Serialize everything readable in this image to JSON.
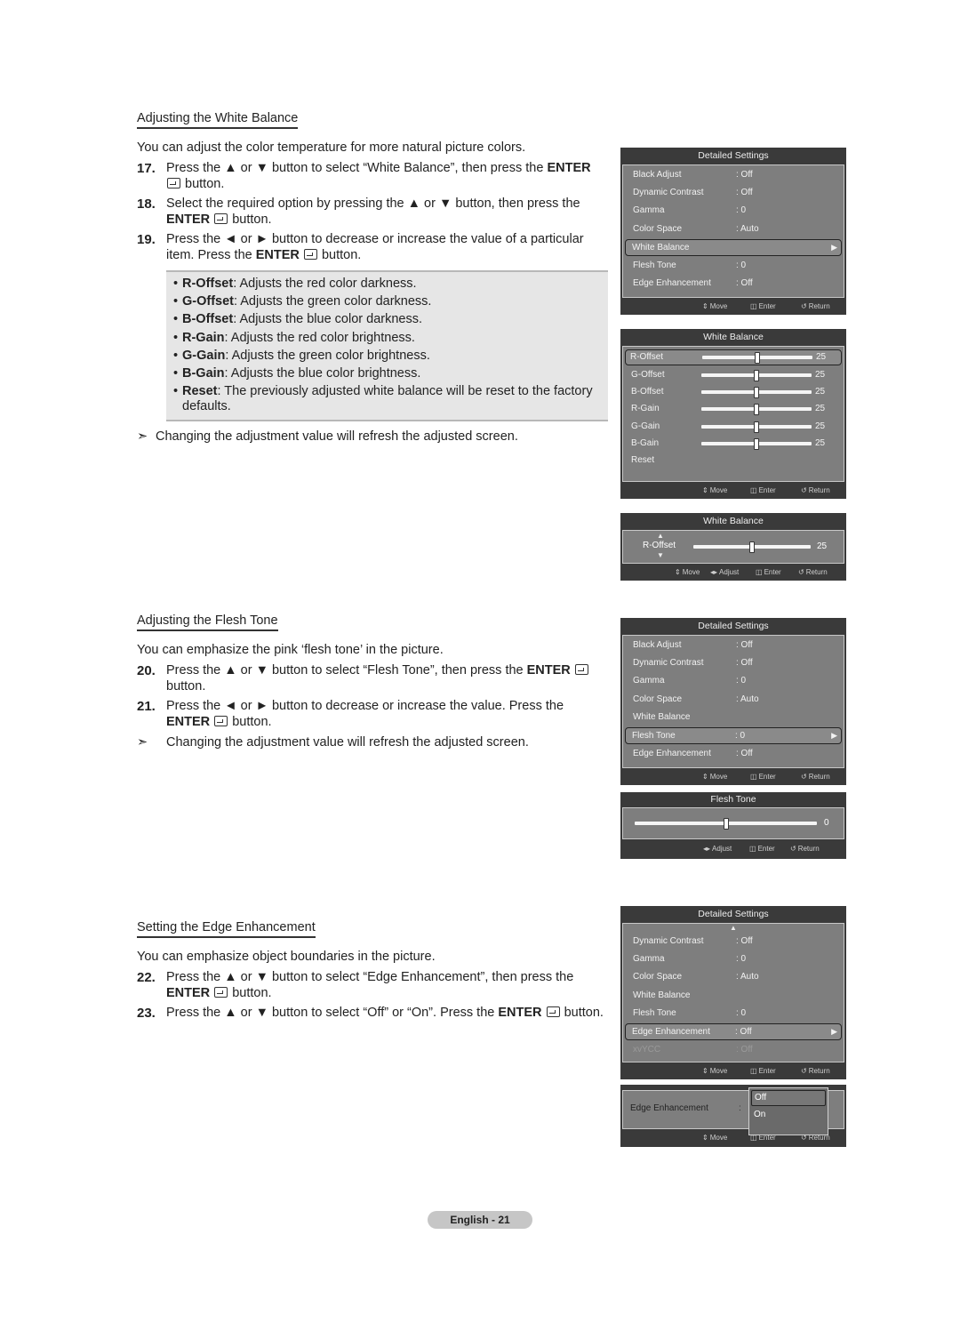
{
  "sections": {
    "white_balance": {
      "title": "Adjusting the White Balance",
      "intro": "You can adjust the color temperature for more natural picture colors.",
      "steps": [
        {
          "num": "17.",
          "pre": "Press the ▲ or ▼ button to select “White Balance”, then press the ",
          "bold": "ENTER",
          "post": " button."
        },
        {
          "num": "18.",
          "pre": "Select the required option by pressing the ▲ or ▼ button, then press the ",
          "bold": "ENTER",
          "post": " button."
        },
        {
          "num": "19.",
          "pre": "Press the ◄ or ► button to decrease or increase the value of a particular item. Press the ",
          "bold": "ENTER",
          "post": " button."
        }
      ],
      "bullets": [
        {
          "term": "R-Offset",
          "desc": ": Adjusts the red color darkness."
        },
        {
          "term": "G-Offset",
          "desc": ": Adjusts the green color darkness."
        },
        {
          "term": "B-Offset",
          "desc": ": Adjusts the blue color darkness."
        },
        {
          "term": "R-Gain",
          "desc": ": Adjusts the red color brightness."
        },
        {
          "term": "G-Gain",
          "desc": ": Adjusts the green color brightness."
        },
        {
          "term": "B-Gain",
          "desc": ": Adjusts the blue color brightness."
        },
        {
          "term": "Reset",
          "desc": ": The previously adjusted white balance will be reset to the factory defaults."
        }
      ],
      "note": "Changing the adjustment value will refresh the adjusted screen."
    },
    "flesh_tone": {
      "title": "Adjusting the Flesh Tone",
      "intro": "You can emphasize the pink ‘flesh tone’ in the picture.",
      "steps": [
        {
          "num": "20.",
          "pre": "Press the ▲ or ▼ button to select “Flesh Tone”, then press the ",
          "bold": "ENTER",
          "post": " button."
        },
        {
          "num": "21.",
          "pre": "Press the ◄ or ► button to decrease or increase the value. Press the ",
          "bold": "ENTER",
          "post": " button."
        }
      ],
      "note": "Changing the adjustment value will refresh the adjusted screen."
    },
    "edge_enhancement": {
      "title": "Setting the Edge Enhancement",
      "intro": "You can emphasize object boundaries in the picture.",
      "steps": [
        {
          "num": "22.",
          "pre": "Press the ▲ or ▼ button to select “Edge Enhancement”, then press the ",
          "bold": "ENTER",
          "post": " button."
        },
        {
          "num": "23.",
          "pre": "Press the ▲ or ▼ button to select “Off” or “On”. Press the ",
          "bold": "ENTER",
          "post": " button."
        }
      ]
    }
  },
  "osd": {
    "footer": {
      "move": "Move",
      "adjust": "Adjust",
      "enter": "Enter",
      "return": "Return"
    },
    "detailed1": {
      "title": "Detailed Settings",
      "rows": [
        {
          "label": "Black Adjust",
          "value": ": Off"
        },
        {
          "label": "Dynamic Contrast",
          "value": ": Off"
        },
        {
          "label": "Gamma",
          "value": ": 0"
        },
        {
          "label": "Color Space",
          "value": ": Auto"
        },
        {
          "label": "White Balance",
          "value": ""
        },
        {
          "label": "Flesh Tone",
          "value": ": 0"
        },
        {
          "label": "Edge Enhancement",
          "value": ": Off"
        }
      ]
    },
    "wb": {
      "title": "White Balance",
      "rows": [
        {
          "label": "R-Offset",
          "value": "25",
          "level": 0.5
        },
        {
          "label": "G-Offset",
          "value": "25",
          "level": 0.5
        },
        {
          "label": "B-Offset",
          "value": "25",
          "level": 0.5
        },
        {
          "label": "R-Gain",
          "value": "25",
          "level": 0.5
        },
        {
          "label": "G-Gain",
          "value": "25",
          "level": 0.5
        },
        {
          "label": "B-Gain",
          "value": "25",
          "level": 0.5
        }
      ],
      "reset": "Reset"
    },
    "wb_single": {
      "title": "White Balance",
      "label": "R-Offset",
      "value": "25",
      "level": 0.5
    },
    "detailed2": {
      "title": "Detailed Settings",
      "rows": [
        {
          "label": "Black Adjust",
          "value": ": Off"
        },
        {
          "label": "Dynamic Contrast",
          "value": ": Off"
        },
        {
          "label": "Gamma",
          "value": ": 0"
        },
        {
          "label": "Color Space",
          "value": ": Auto"
        },
        {
          "label": "White Balance",
          "value": ""
        },
        {
          "label": "Flesh Tone",
          "value": ": 0"
        },
        {
          "label": "Edge Enhancement",
          "value": ": Off"
        }
      ]
    },
    "flesh": {
      "title": "Flesh Tone",
      "value": "0",
      "level": 0.5
    },
    "detailed3": {
      "title": "Detailed Settings",
      "rows": [
        {
          "label": "Dynamic Contrast",
          "value": ": Off"
        },
        {
          "label": "Gamma",
          "value": ": 0"
        },
        {
          "label": "Color Space",
          "value": ": Auto"
        },
        {
          "label": "White Balance",
          "value": ""
        },
        {
          "label": "Flesh Tone",
          "value": ": 0"
        },
        {
          "label": "Edge Enhancement",
          "value": ": Off"
        },
        {
          "label": "xvYCC",
          "value": ": Off"
        }
      ]
    },
    "edge_popup": {
      "label": "Edge Enhancement",
      "colon": ":",
      "options": [
        "Off",
        "On"
      ]
    }
  },
  "page_label": "English - 21"
}
